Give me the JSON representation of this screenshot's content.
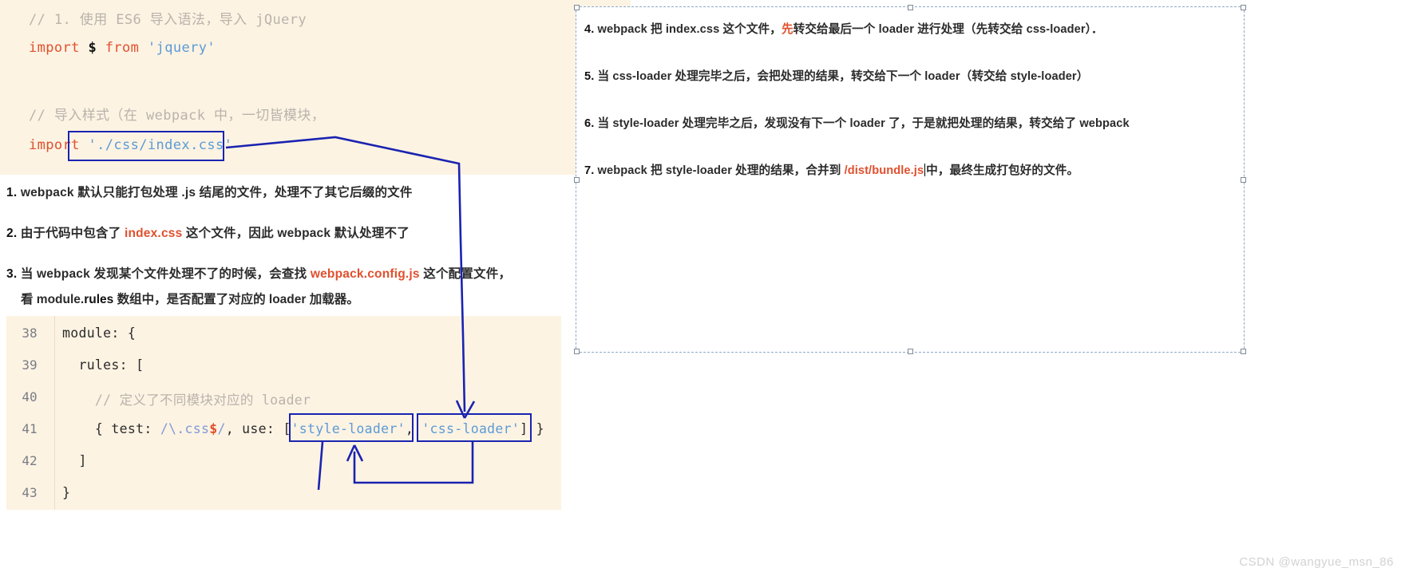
{
  "top_code": {
    "lines": [
      {
        "segs": [
          {
            "t": "// 1. 使用 ES6 导入语法，导入 jQuery",
            "c": "comment"
          }
        ]
      },
      {
        "segs": [
          {
            "t": "import ",
            "c": "kw"
          },
          {
            "t": "$ ",
            "c": "var"
          },
          {
            "t": "from ",
            "c": "kw"
          },
          {
            "t": "'jquery'",
            "c": "str"
          }
        ]
      },
      {
        "segs": [
          {
            "t": "",
            "c": "plain"
          }
        ]
      },
      {
        "segs": [
          {
            "t": "// 导入样式（在 webpack 中，一切皆模块，",
            "c": "comment"
          }
        ]
      },
      {
        "segs": [
          {
            "t": "import ",
            "c": "kw"
          },
          {
            "t": "'./css/index.css'",
            "c": "str"
          }
        ]
      }
    ]
  },
  "notes": [
    {
      "num": "1.",
      "parts": [
        {
          "t": "webpack 默认只能打包处理 .js 结尾的文件，处理不了其它后缀的文件",
          "c": "plain"
        }
      ]
    },
    {
      "num": "2.",
      "parts": [
        {
          "t": "由于代码中包含了 ",
          "c": "plain"
        },
        {
          "t": "index.css",
          "c": "red"
        },
        {
          "t": " 这个文件，因此 webpack 默认处理不了",
          "c": "plain"
        }
      ]
    },
    {
      "num": "3.",
      "parts": [
        {
          "t": "当 webpack 发现某个文件处理不了的时候，会查找 ",
          "c": "plain"
        },
        {
          "t": "webpack.config.js",
          "c": "red"
        },
        {
          "t": " 这个配置文件，",
          "c": "plain"
        }
      ]
    }
  ],
  "note3_second_line": [
    {
      "t": "看 module.",
      "c": "plain"
    },
    {
      "t": "rules",
      "c": "red"
    },
    {
      "t": " 数组中，是否配置了对应的 loader 加载器。",
      "c": "plain"
    }
  ],
  "bottom_code": {
    "rows": [
      {
        "num": "38",
        "segs": [
          {
            "t": "module: {",
            "c": "plain"
          }
        ]
      },
      {
        "num": "39",
        "segs": [
          {
            "t": "  rules: [",
            "c": "plain"
          }
        ]
      },
      {
        "num": "40",
        "segs": [
          {
            "t": "    // 定义了不同模块对应的 loader",
            "c": "comment"
          }
        ]
      },
      {
        "num": "41",
        "segs": [
          {
            "t": "    { test: ",
            "c": "plain"
          },
          {
            "t": "/\\.css",
            "c": "re"
          },
          {
            "t": "$",
            "c": "re-dollar"
          },
          {
            "t": "/",
            "c": "re"
          },
          {
            "t": ", use: [",
            "c": "plain"
          },
          {
            "t": "'style-loader'",
            "c": "str"
          },
          {
            "t": ", ",
            "c": "plain"
          },
          {
            "t": "'css-loader'",
            "c": "str"
          },
          {
            "t": "] }",
            "c": "plain"
          }
        ]
      },
      {
        "num": "42",
        "segs": [
          {
            "t": "  ]",
            "c": "plain"
          }
        ]
      },
      {
        "num": "43",
        "segs": [
          {
            "t": "}",
            "c": "plain"
          }
        ]
      }
    ]
  },
  "right_notes": [
    {
      "num": "4.",
      "parts": [
        {
          "t": "webpack 把 index.css 这个文件，",
          "c": "plain"
        },
        {
          "t": "先",
          "c": "red"
        },
        {
          "t": "转交给最后一个 loader 进行处理（先转交给 css-loader）．",
          "c": "plain"
        }
      ]
    },
    {
      "num": "5.",
      "parts": [
        {
          "t": "当 css-loader 处理完毕之后，会把处理的结果，转交给下一个 loader（转交给 style-loader）",
          "c": "plain"
        }
      ]
    },
    {
      "num": "6.",
      "parts": [
        {
          "t": "当 style-loader 处理完毕之后，发现没有下一个 loader 了，于是就把处理的结果，转交给了 webpack",
          "c": "plain"
        }
      ]
    },
    {
      "num": "7.",
      "parts": [
        {
          "t": "webpack 把 style-loader 处理的结果，合并到 ",
          "c": "plain"
        },
        {
          "t": "/dist/bundle.js",
          "c": "red"
        },
        {
          "t": "CARET",
          "c": "caret"
        },
        {
          "t": "中，最终生成打包好的文件。",
          "c": "plain"
        }
      ]
    }
  ],
  "watermark": {
    "text": "CSDN @wangyue_msn_86"
  },
  "colors": {
    "code_bg": "#fdf3e3",
    "annotation_blue": "#1a23b0",
    "accent_red": "#e0502e",
    "string_blue": "#5b9bd5",
    "comment_grey": "#b9b3ab",
    "panel_dash": "#8fa8c8"
  }
}
